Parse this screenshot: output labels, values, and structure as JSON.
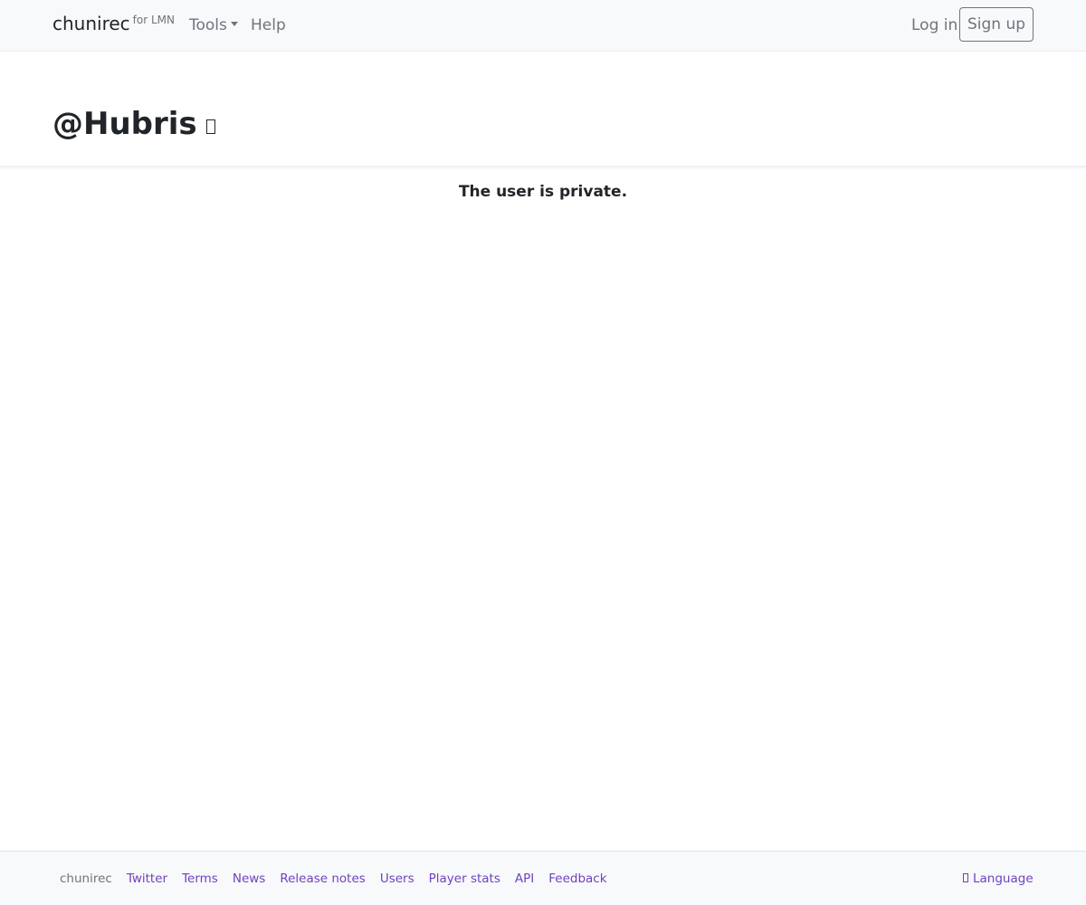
{
  "navbar": {
    "brand": "chunirec",
    "brand_sup": "for LMN",
    "tools": "Tools",
    "help": "Help",
    "login": "Log in",
    "signup": "Sign up"
  },
  "header": {
    "title": "@Hubris",
    "title_icon": "missing-glyph-icon"
  },
  "main": {
    "message": "The user is private."
  },
  "footer": {
    "brand": "chunirec",
    "links": [
      "Twitter",
      "Terms",
      "News",
      "Release notes",
      "Users",
      "Player stats",
      "API",
      "Feedback"
    ],
    "language": "Language",
    "language_icon": "globe-icon",
    "link_color": "#6f42c1"
  }
}
